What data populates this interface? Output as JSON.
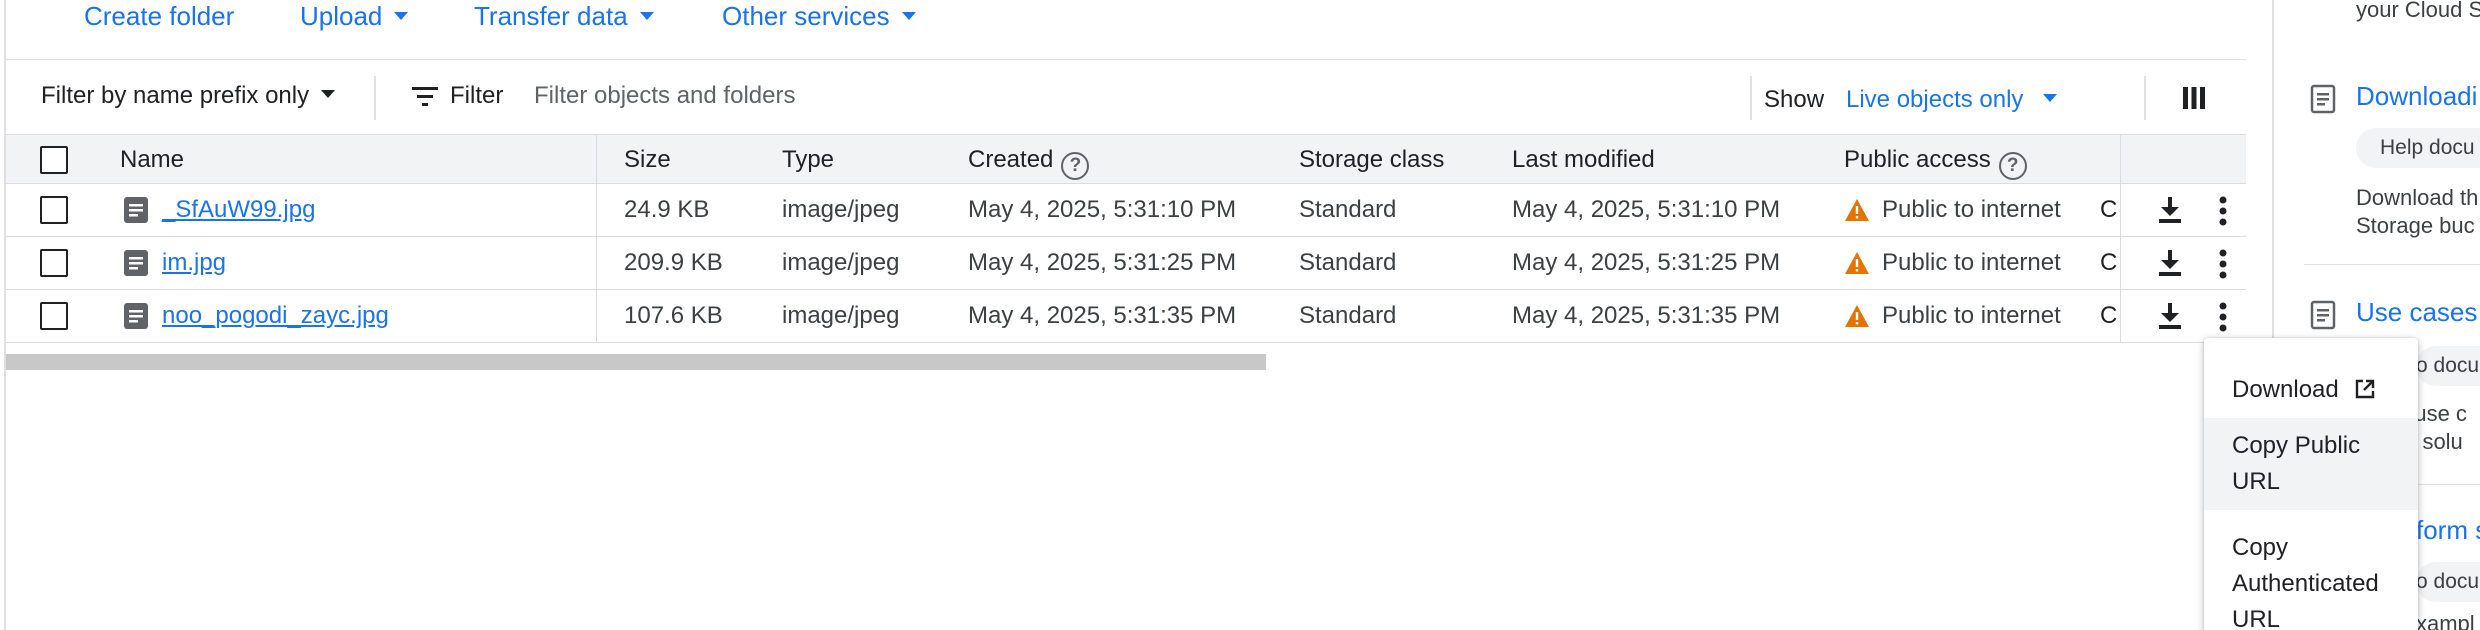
{
  "toolbar": {
    "create_folder": "Create folder",
    "upload": "Upload",
    "transfer_data": "Transfer data",
    "other_services": "Other services"
  },
  "filter_bar": {
    "filter_mode": "Filter by name prefix only",
    "filter_label": "Filter",
    "filter_placeholder": "Filter objects and folders",
    "show_label": "Show",
    "show_value": "Live objects only"
  },
  "table": {
    "columns": [
      "Name",
      "Size",
      "Type",
      "Created",
      "Storage class",
      "Last modified",
      "Public access"
    ],
    "rows": [
      {
        "name": "_SfAuW99.jpg",
        "size": "24.9 KB",
        "type": "image/jpeg",
        "created": "May 4, 2025, 5:31:10 PM",
        "storage_class": "Standard",
        "last_modified": "May 4, 2025, 5:31:10 PM",
        "public_access": "Public to internet",
        "extra": "C"
      },
      {
        "name": "im.jpg",
        "size": "209.9 KB",
        "type": "image/jpeg",
        "created": "May 4, 2025, 5:31:25 PM",
        "storage_class": "Standard",
        "last_modified": "May 4, 2025, 5:31:25 PM",
        "public_access": "Public to internet",
        "extra": "C"
      },
      {
        "name": "noo_pogodi_zayc.jpg",
        "size": "107.6 KB",
        "type": "image/jpeg",
        "created": "May 4, 2025, 5:31:35 PM",
        "storage_class": "Standard",
        "last_modified": "May 4, 2025, 5:31:35 PM",
        "public_access": "Public to internet",
        "extra": "C"
      }
    ]
  },
  "context_menu": {
    "download": "Download",
    "copy_public_url_1": "Copy Public",
    "copy_public_url_2": "URL",
    "copy_auth_url_1": "Copy",
    "copy_auth_url_2": "Authenticated",
    "copy_auth_url_3": "URL"
  },
  "right_panel": {
    "top_text": "your Cloud S",
    "section1_title": "Downloadi",
    "section1_chip": "Help docu",
    "section1_desc_1": "Download th",
    "section1_desc_2": "Storage buc",
    "section2_title": "Use cases",
    "section2_chip": "o docu",
    "section2_desc_1": "e use c",
    "section2_desc_2": "ry solu",
    "section3_title": "form s",
    "section3_chip": "o docu",
    "section3_desc_1": "xampl"
  },
  "colors": {
    "accent": "#1a73e8",
    "warning": "#e37400",
    "header_bg": "#f1f3f4"
  }
}
